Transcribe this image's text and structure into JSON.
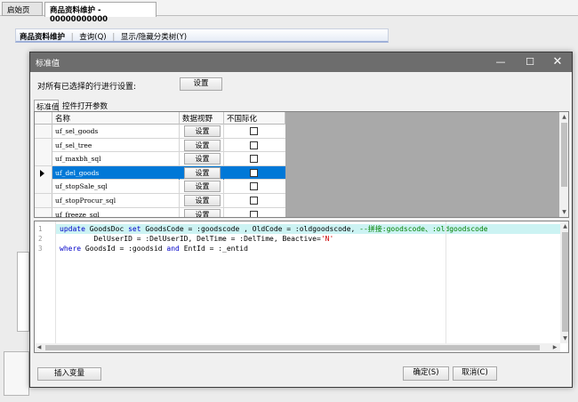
{
  "app": {
    "tabs": [
      "启始页",
      "商品资料维护 - 00000000000"
    ],
    "toolbar": {
      "items": [
        "商品资料维护",
        "查询(Q)",
        "显示/隐藏分类树(Y)"
      ]
    }
  },
  "dialog": {
    "title": "标准值",
    "apply_all_label": "对所有已选择的行进行设置:",
    "apply_all_button": "设置",
    "tabs": [
      "标准值",
      "控件打开参数"
    ],
    "grid": {
      "columns": [
        "名称",
        "数据视野",
        "不国际化"
      ],
      "rows": [
        {
          "name": "uf_sel_goods",
          "btn": "设置",
          "checked": false,
          "selected": false
        },
        {
          "name": "uf_sel_tree",
          "btn": "设置",
          "checked": false,
          "selected": false
        },
        {
          "name": "uf_maxbh_sql",
          "btn": "设置",
          "checked": false,
          "selected": false
        },
        {
          "name": "uf_del_goods",
          "btn": "设置",
          "checked": false,
          "selected": true
        },
        {
          "name": "uf_stopSale_sql",
          "btn": "设置",
          "checked": false,
          "selected": false
        },
        {
          "name": "uf_stopProcur_sql",
          "btn": "设置",
          "checked": false,
          "selected": false
        },
        {
          "name": "uf_freeze_sql",
          "btn": "设置",
          "checked": false,
          "selected": false
        }
      ]
    },
    "editor": {
      "line_numbers": [
        "1",
        "2",
        "3"
      ],
      "lines": [
        {
          "kw1": "update",
          "t1": " GoodsDoc ",
          "kw2": "set",
          "t2": " GoodsCode = :goodscode , OldCode = :oldgoodscode, ",
          "comment": "--拼接:goodscode、:oldgoodscode"
        },
        {
          "t1": "        DelUserID = :DelUserID, DelTime = :DelTime, Beactive=",
          "str": "'N'"
        },
        {
          "kw1": "where",
          "t1": " GoodsId = :goodsid ",
          "kw2": "and",
          "t2": " EntId = :_entid"
        }
      ]
    },
    "buttons": {
      "insert_var": "插入变量",
      "ok": "确定(S)",
      "cancel": "取消(C)"
    }
  }
}
